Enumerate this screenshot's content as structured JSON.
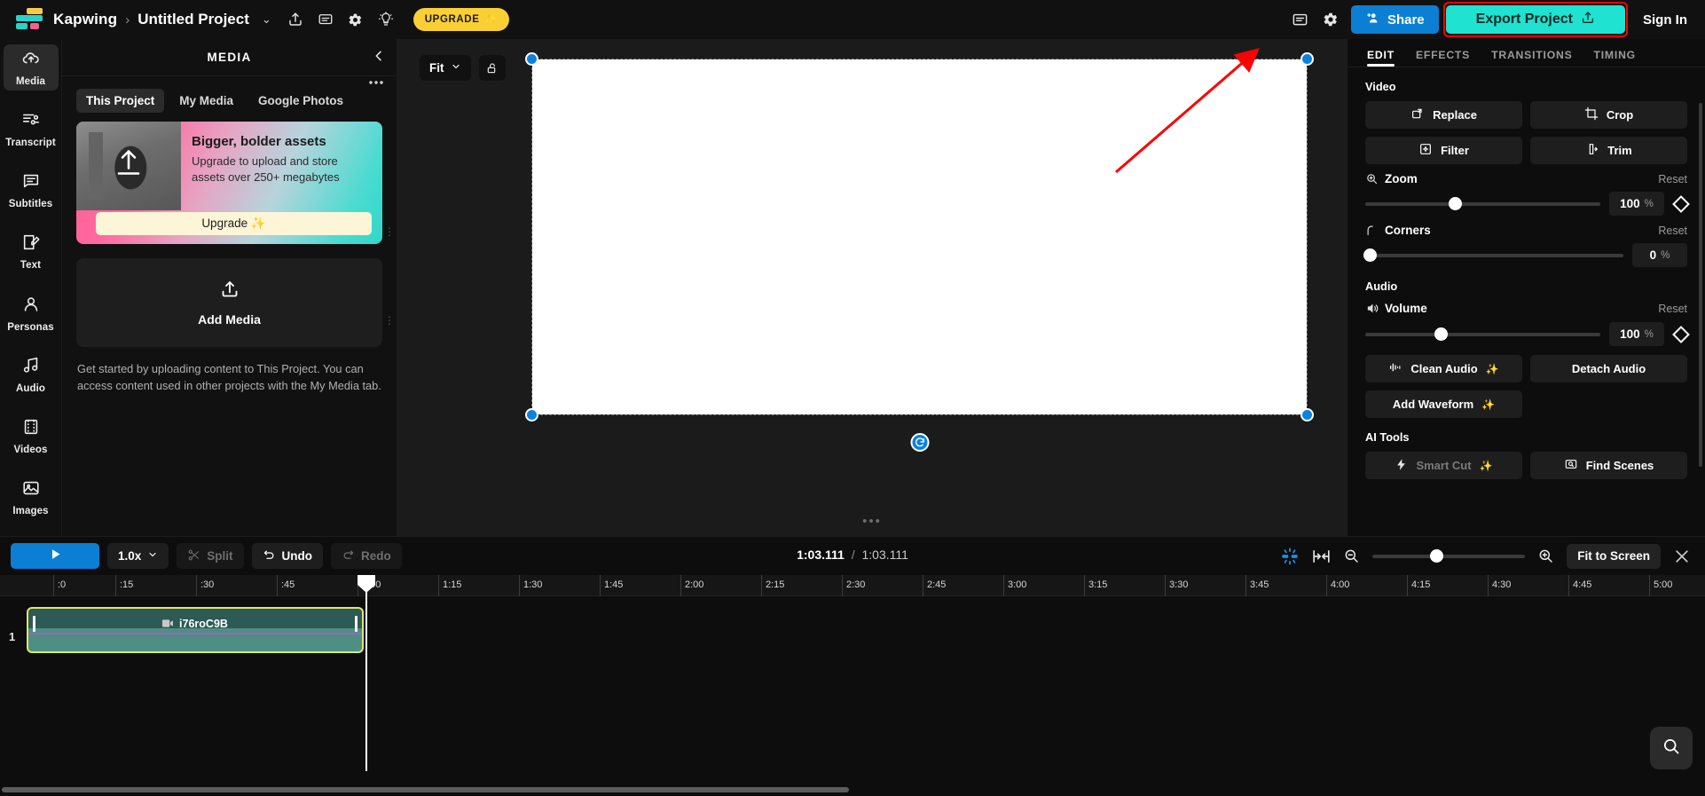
{
  "topbar": {
    "brand": "Kapwing",
    "crumb_sep": "›",
    "project_name": "Untitled Project",
    "caret": "⌄",
    "share_label": "Share",
    "export_label": "Export Project",
    "signin_label": "Sign In",
    "upgrade_label": "UPGRADE",
    "upgrade_sparkle": "✨",
    "icons": {
      "share_upload": "upload-icon",
      "comment": "comment-icon",
      "settings": "gear-icon",
      "tips": "lightbulb-icon"
    },
    "accent_blue": "#0b7fd4",
    "accent_teal": "#1fe3d0",
    "accent_yellow": "#f9cf33",
    "highlight_color": "#ff0000"
  },
  "rail": {
    "items": [
      {
        "label": "Media",
        "icon": "cloud-upload-icon",
        "active": true
      },
      {
        "label": "Transcript",
        "icon": "transcript-icon",
        "active": false
      },
      {
        "label": "Subtitles",
        "icon": "subtitles-icon",
        "active": false
      },
      {
        "label": "Text",
        "icon": "text-edit-icon",
        "active": false
      },
      {
        "label": "Personas",
        "icon": "person-icon",
        "active": false
      },
      {
        "label": "Audio",
        "icon": "music-note-icon",
        "active": false
      },
      {
        "label": "Videos",
        "icon": "film-icon",
        "active": false
      },
      {
        "label": "Images",
        "icon": "image-icon",
        "active": false
      }
    ]
  },
  "media": {
    "title": "MEDIA",
    "collapse_icon": "chevron-left-icon",
    "more_icon": "ellipsis-icon",
    "tabs": [
      {
        "label": "This Project",
        "active": true
      },
      {
        "label": "My Media",
        "active": false
      },
      {
        "label": "Google Photos",
        "active": false
      }
    ],
    "promo": {
      "heading": "Bigger, bolder assets",
      "body": "Upgrade to upload and store assets over 250+ megabytes",
      "button": "Upgrade ✨"
    },
    "add_media_label": "Add Media",
    "add_media_icon": "upload-icon",
    "hint": "Get started by uploading content to This Project. You can access content used in other projects with the My Media tab."
  },
  "stage": {
    "fit_label": "Fit",
    "fit_caret": "⌄",
    "lock_icon": "unlock-icon",
    "rotate_icon": "rotate-icon",
    "handles_color": "#0b82e0",
    "canvas_color": "#ffffff",
    "drag_dots": "•••"
  },
  "right_panel": {
    "tabs": [
      {
        "label": "EDIT",
        "active": true
      },
      {
        "label": "EFFECTS",
        "active": false
      },
      {
        "label": "TRANSITIONS",
        "active": false
      },
      {
        "label": "TIMING",
        "active": false
      }
    ],
    "video_section": {
      "title": "Video",
      "buttons": [
        {
          "label": "Replace",
          "icon": "replace-icon"
        },
        {
          "label": "Crop",
          "icon": "crop-icon"
        },
        {
          "label": "Filter",
          "icon": "filter-icon"
        },
        {
          "label": "Trim",
          "icon": "trim-icon"
        }
      ],
      "zoom": {
        "label": "Zoom",
        "icon": "zoom-in-icon",
        "reset": "Reset",
        "value": "100",
        "unit": "%",
        "percent": 38
      },
      "corners": {
        "label": "Corners",
        "icon": "corner-icon",
        "reset": "Reset",
        "value": "0",
        "unit": "%",
        "percent": 0
      }
    },
    "audio_section": {
      "title": "Audio",
      "volume": {
        "label": "Volume",
        "icon": "speaker-icon",
        "reset": "Reset",
        "value": "100",
        "unit": "%",
        "percent": 32
      },
      "buttons": [
        {
          "label": "Clean Audio",
          "icon": "waveform-icon",
          "sparkle": "✨",
          "disabled": false
        },
        {
          "label": "Detach Audio",
          "icon": "",
          "sparkle": "",
          "disabled": false
        },
        {
          "label": "Add Waveform",
          "icon": "",
          "sparkle": "✨",
          "disabled": false
        }
      ]
    },
    "ai_section": {
      "title": "AI Tools",
      "buttons": [
        {
          "label": "Smart Cut",
          "icon": "bolt-icon",
          "sparkle": "✨",
          "disabled": true
        },
        {
          "label": "Find Scenes",
          "icon": "find-scenes-icon",
          "sparkle": "",
          "disabled": false
        }
      ]
    }
  },
  "timeline": {
    "play_icon": "play-icon",
    "speed_label": "1.0x",
    "speed_caret": "⌄",
    "split_label": "Split",
    "split_icon": "scissors-icon",
    "undo_label": "Undo",
    "undo_icon": "undo-icon",
    "redo_label": "Redo",
    "redo_icon": "redo-icon",
    "current_time": "1:03.111",
    "separator": "/",
    "total_time": "1:03.111",
    "drag_dots": "•••",
    "magnet_icon": "snap-icon",
    "fit_selection_icon": "fit-selection-icon",
    "zoom_out_icon": "zoom-out-icon",
    "zoom_in_icon": "zoom-in-icon",
    "zoom_percent": 42,
    "fit_to_screen_label": "Fit to Screen",
    "close_icon": "close-icon",
    "search_icon": "search-icon",
    "ruler_ticks": [
      ":0",
      ":15",
      ":30",
      ":45",
      "1:00",
      "1:15",
      "1:30",
      "1:45",
      "2:00",
      "2:15",
      "2:30",
      "2:45",
      "3:00",
      "3:15",
      "3:30",
      "3:45",
      "4:00",
      "4:15",
      "4:30",
      "4:45",
      "5:00"
    ],
    "track_number": "1",
    "clip": {
      "name": "i76roC9B",
      "icon": "video-clip-icon",
      "border_color": "#dbe86b",
      "fill_top": "#2d5a54",
      "fill_bottom": "#4e8e83",
      "audio_line_color": "#a05fc8"
    }
  }
}
